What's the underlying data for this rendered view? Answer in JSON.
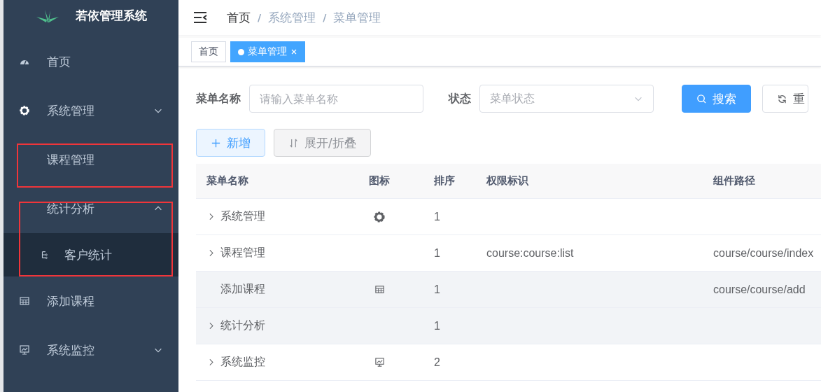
{
  "sidebar": {
    "logo_title": "若依管理系统",
    "items": [
      {
        "label": "首页",
        "kind": "link",
        "highlighted": false
      },
      {
        "label": "系统管理",
        "kind": "submenu",
        "expanded": false,
        "highlighted": false
      },
      {
        "label": "课程管理",
        "kind": "link",
        "highlighted": true
      },
      {
        "label": "统计分析",
        "kind": "submenu",
        "expanded": true,
        "highlighted": true,
        "children": [
          {
            "label": "客户统计"
          }
        ]
      },
      {
        "label": "添加课程",
        "kind": "link",
        "highlighted": false
      },
      {
        "label": "系统监控",
        "kind": "submenu",
        "expanded": false,
        "highlighted": false
      }
    ]
  },
  "breadcrumb": [
    {
      "label": "首页"
    },
    {
      "separator": "/",
      "label": "系统管理"
    },
    {
      "separator": "/",
      "label": "菜单管理"
    }
  ],
  "tags": [
    {
      "label": "首页",
      "selected": false
    },
    {
      "label": "菜单管理",
      "selected": true
    }
  ],
  "search_form": {
    "fields": [
      {
        "label": "菜单名称",
        "placeholder": "请输入菜单名称",
        "kind": "input"
      },
      {
        "label": "状态",
        "placeholder": "菜单状态",
        "kind": "select"
      }
    ],
    "buttons": [
      {
        "label": "搜索",
        "kind": "primary"
      },
      {
        "label": "重",
        "kind": "default"
      }
    ]
  },
  "toolbar": [
    {
      "label": "新增",
      "kind": "plain"
    },
    {
      "label": "展开/折叠",
      "kind": "info"
    }
  ],
  "table": {
    "columns": [
      "菜单名称",
      "图标",
      "排序",
      "权限标识",
      "组件路径"
    ],
    "rows": [
      {
        "name": "系统管理",
        "has_children": true,
        "order": "1",
        "hovered": false
      },
      {
        "name": "课程管理",
        "has_children": true,
        "order": "1",
        "perms": "course:course:list",
        "component": "course/course/index",
        "hovered": false
      },
      {
        "name": "添加课程",
        "has_children": false,
        "order": "1",
        "component": "course/course/add",
        "hovered": true
      },
      {
        "name": "统计分析",
        "has_children": true,
        "order": "1",
        "hovered": true
      },
      {
        "name": "系统监控",
        "has_children": true,
        "order": "2",
        "hovered": false
      }
    ]
  }
}
